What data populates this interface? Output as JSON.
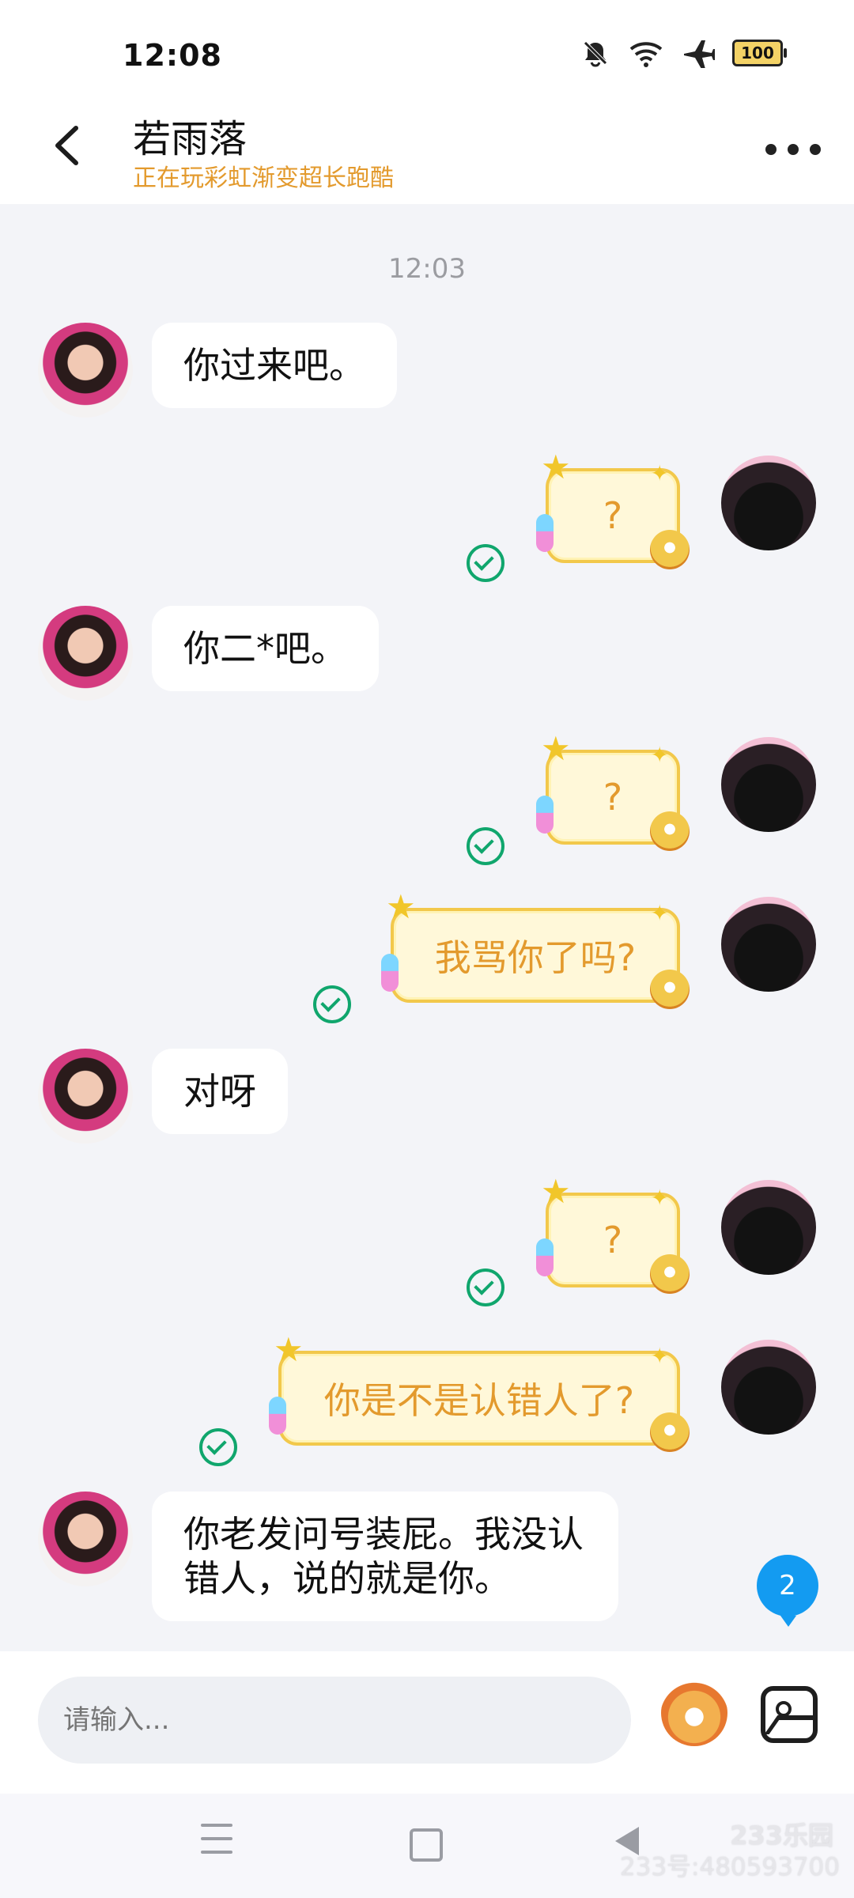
{
  "status_bar": {
    "time": "12:08",
    "battery": "100",
    "icons": [
      "bell-off-icon",
      "wifi-icon",
      "airplane-icon",
      "battery-icon"
    ]
  },
  "header": {
    "name": "若雨落",
    "status": "正在玩彩虹渐变超长跑酷",
    "back_icon": "back-arrow-icon",
    "more_icon": "more-options-icon"
  },
  "chat": {
    "timestamp": "12:03",
    "messages": [
      {
        "side": "left",
        "text": "你过来吧。"
      },
      {
        "side": "right",
        "text": "?"
      },
      {
        "side": "left",
        "text": "你二*吧。"
      },
      {
        "side": "right",
        "text": "?"
      },
      {
        "side": "right",
        "text": "我骂你了吗?"
      },
      {
        "side": "left",
        "text": "对呀"
      },
      {
        "side": "right",
        "text": "?"
      },
      {
        "side": "right",
        "text": "你是不是认错人了?"
      },
      {
        "side": "left",
        "text": "你老发问号装屁。我没认错人，说的就是你。"
      }
    ],
    "unread_badge": "2"
  },
  "input": {
    "placeholder": "请输入..."
  },
  "watermark": {
    "logo": "233乐园",
    "text": "233号:480593700"
  },
  "colors": {
    "accent": "#e39a2d",
    "read_check": "#10a66d",
    "badge": "#139bf1"
  }
}
